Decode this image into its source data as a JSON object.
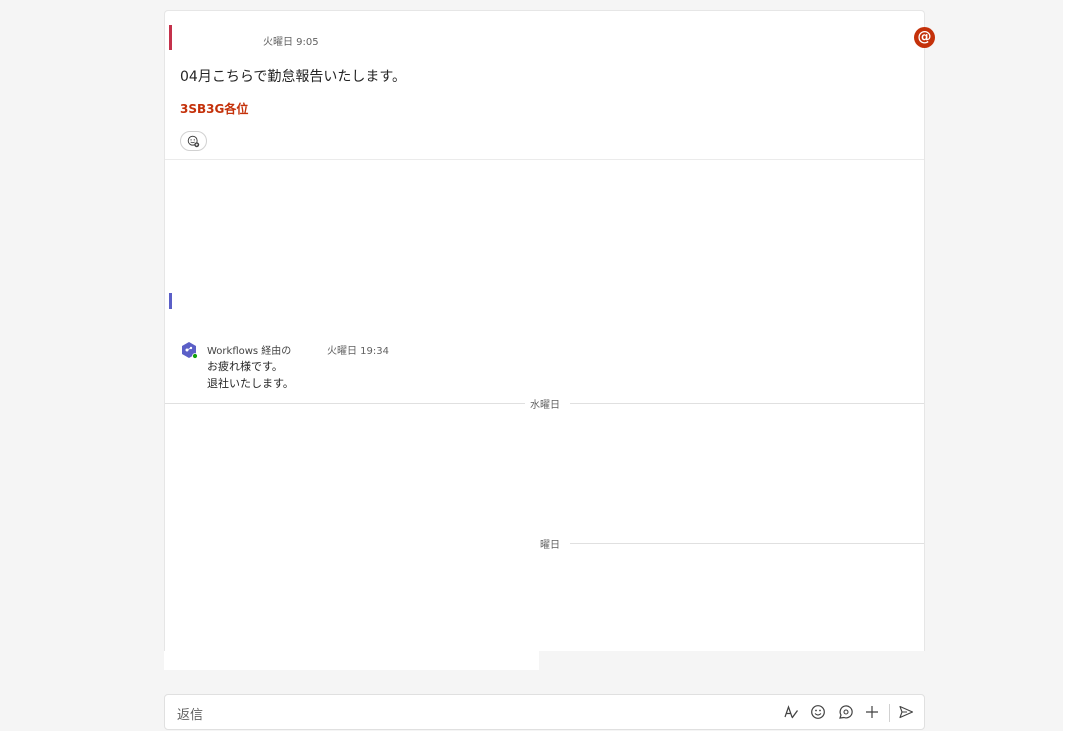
{
  "post": {
    "time": "火曜日 9:05",
    "body": "04月こちらで勤怠報告いたします。",
    "mention": "3SB3G各位",
    "mention_badge": "@"
  },
  "reply_message": {
    "sender": "Workflows 経由の",
    "time": "火曜日 19:34",
    "lines": [
      "お疲れ様です。",
      "退社いたします。"
    ]
  },
  "dividers": {
    "day1": "水曜日",
    "day2": "曜日"
  },
  "composer": {
    "placeholder": "返信",
    "tools": [
      "format-icon",
      "emoji-icon",
      "loop-icon",
      "add-icon",
      "send-icon"
    ]
  },
  "colors": {
    "accent_red": "#c4314b",
    "mention_orange": "#c4310a",
    "accent_blue": "#5b5fc7"
  }
}
